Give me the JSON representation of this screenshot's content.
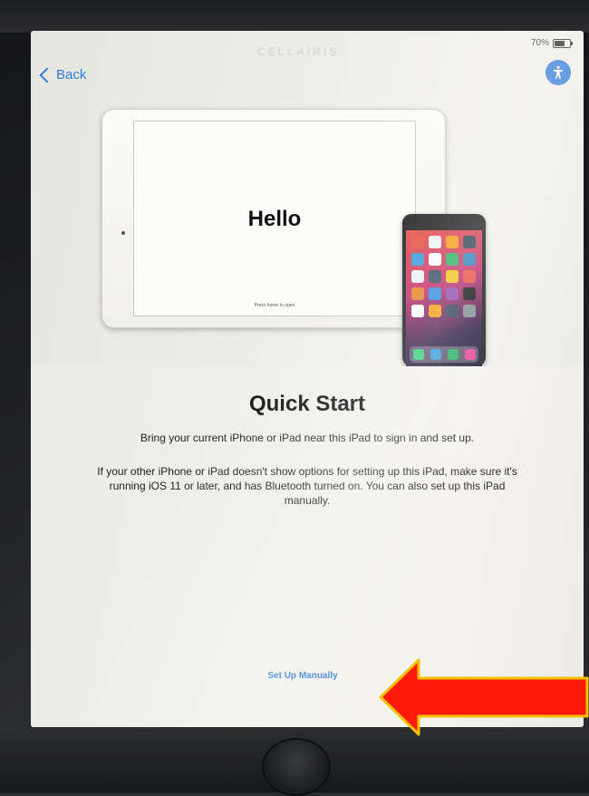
{
  "screen": {
    "watermark": "CELLAIRIS",
    "battery_text": "70%",
    "back_label": "Back",
    "accessibility_icon": "accessibility-icon"
  },
  "illustration": {
    "ipad_text": "Hello",
    "ipad_hint": "Press home to open"
  },
  "quick_start": {
    "title": "Quick Start",
    "subtitle": "Bring your current iPhone or iPad near this iPad to sign in and set up.",
    "info": "If your other iPhone or iPad doesn't show options for setting up this iPad, make sure it's running iOS 11 or later, and has Bluetooth turned on. You can also set up this iPad manually.",
    "manual_button": "Set Up Manually"
  },
  "annotation": {
    "arrow_color": "#ff1a0a",
    "arrow_outline": "#f2c200"
  },
  "colors": {
    "link_blue": "#2f7bd6",
    "accessibility_blue": "#3a7fd8"
  }
}
